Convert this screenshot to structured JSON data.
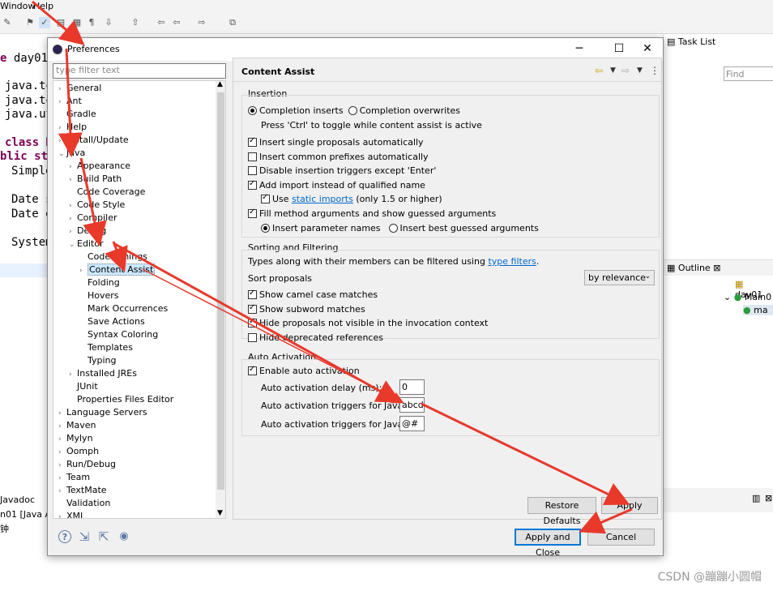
{
  "menubar": {
    "window": "Window",
    "help": "Help"
  },
  "editor": {
    "lines": [
      "e day01;",
      "java.te",
      "java.te",
      "java.ut",
      "class M",
      "blic sta",
      "Simple",
      "Date s",
      "Date e",
      "System"
    ]
  },
  "bottom_left": {
    "tab": "Javadoc",
    "line1": "n01 [Java Ap",
    "line2": "钟"
  },
  "right_panel": {
    "tasklist_title": "Task List",
    "find_placeholder": "Find",
    "outline_title": "Outline",
    "outline_items": [
      "day01",
      "Main0",
      "ma"
    ]
  },
  "dialog": {
    "title": "Preferences",
    "filter_placeholder": "type filter text",
    "tree": [
      {
        "label": "General",
        "level": 0,
        "arrow": "›"
      },
      {
        "label": "Ant",
        "level": 0,
        "arrow": "›"
      },
      {
        "label": "Gradle",
        "level": 0,
        "arrow": ""
      },
      {
        "label": "Help",
        "level": 0,
        "arrow": "›"
      },
      {
        "label": "Install/Update",
        "level": 0,
        "arrow": "›"
      },
      {
        "label": "Java",
        "level": 0,
        "arrow": "⌄"
      },
      {
        "label": "Appearance",
        "level": 1,
        "arrow": "›"
      },
      {
        "label": "Build Path",
        "level": 1,
        "arrow": "›"
      },
      {
        "label": "Code Coverage",
        "level": 1,
        "arrow": ""
      },
      {
        "label": "Code Style",
        "level": 1,
        "arrow": "›"
      },
      {
        "label": "Compiler",
        "level": 1,
        "arrow": "›"
      },
      {
        "label": "Debug",
        "level": 1,
        "arrow": "›"
      },
      {
        "label": "Editor",
        "level": 1,
        "arrow": "⌄"
      },
      {
        "label": "Code Minings",
        "level": 2,
        "arrow": ""
      },
      {
        "label": "Content Assist",
        "level": 2,
        "arrow": "›",
        "selected": true
      },
      {
        "label": "Folding",
        "level": 2,
        "arrow": ""
      },
      {
        "label": "Hovers",
        "level": 2,
        "arrow": ""
      },
      {
        "label": "Mark Occurrences",
        "level": 2,
        "arrow": ""
      },
      {
        "label": "Save Actions",
        "level": 2,
        "arrow": ""
      },
      {
        "label": "Syntax Coloring",
        "level": 2,
        "arrow": ""
      },
      {
        "label": "Templates",
        "level": 2,
        "arrow": ""
      },
      {
        "label": "Typing",
        "level": 2,
        "arrow": ""
      },
      {
        "label": "Installed JREs",
        "level": 1,
        "arrow": "›"
      },
      {
        "label": "JUnit",
        "level": 1,
        "arrow": ""
      },
      {
        "label": "Properties Files Editor",
        "level": 1,
        "arrow": ""
      },
      {
        "label": "Language Servers",
        "level": 0,
        "arrow": "›"
      },
      {
        "label": "Maven",
        "level": 0,
        "arrow": "›"
      },
      {
        "label": "Mylyn",
        "level": 0,
        "arrow": "›"
      },
      {
        "label": "Oomph",
        "level": 0,
        "arrow": "›"
      },
      {
        "label": "Run/Debug",
        "level": 0,
        "arrow": "›"
      },
      {
        "label": "Team",
        "level": 0,
        "arrow": "›"
      },
      {
        "label": "TextMate",
        "level": 0,
        "arrow": "›"
      },
      {
        "label": "Validation",
        "level": 0,
        "arrow": ""
      },
      {
        "label": "XML",
        "level": 0,
        "arrow": "›"
      }
    ],
    "page_title": "Content Assist",
    "insertion": {
      "legend": "Insertion",
      "completion_inserts": "Completion inserts",
      "completion_overwrites": "Completion overwrites",
      "toggle_hint": "Press 'Ctrl' to toggle while content assist is active",
      "insert_single": "Insert single proposals automatically",
      "insert_common": "Insert common prefixes automatically",
      "disable_triggers": "Disable insertion triggers except 'Enter'",
      "add_import": "Add import instead of qualified name",
      "use_prefix": "Use",
      "static_imports": "static imports",
      "use_suffix": "(only 1.5 or higher)",
      "fill_method": "Fill method arguments and show guessed arguments",
      "insert_param_names": "Insert parameter names",
      "insert_best_guessed": "Insert best guessed arguments"
    },
    "sorting": {
      "legend": "Sorting and Filtering",
      "types_text": "Types along with their members can be filtered using",
      "type_filters": "type filters",
      "sort_proposals": "Sort proposals",
      "sort_value": "by relevance",
      "camel_case": "Show camel case matches",
      "subword": "Show subword matches",
      "hide_not_visible": "Hide proposals not visible in the invocation context",
      "hide_deprecated": "Hide deprecated references"
    },
    "auto_activation": {
      "legend": "Auto Activation",
      "enable": "Enable auto activation",
      "delay_label": "Auto activation delay (ms):",
      "delay_value": "0",
      "java_label": "Auto activation triggers for Java:",
      "java_value": "abcde",
      "javadoc_label": "Auto activation triggers for Javadoc:",
      "javadoc_value": "@#"
    },
    "buttons": {
      "restore_defaults": "Restore Defaults",
      "apply": "Apply",
      "apply_close": "Apply and Close",
      "cancel": "Cancel"
    }
  },
  "watermark": "CSDN @蹦蹦小圆帽",
  "colors": {
    "arrow": "#e8392b",
    "link": "#0066cc",
    "selection": "#cce8ff"
  }
}
